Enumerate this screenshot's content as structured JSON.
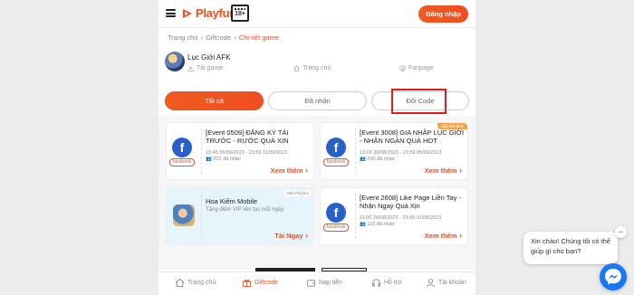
{
  "header": {
    "brand": "Playfun",
    "age_rating": "18+",
    "login_label": "Đăng nhập"
  },
  "breadcrumb": [
    "Trang chủ",
    "Giftcode",
    "Chi tiết game"
  ],
  "game": {
    "name": "Lục Giới AFK",
    "links": [
      {
        "label": "Tải game",
        "icon": "download-icon"
      },
      {
        "label": "Trang chủ",
        "icon": "home-icon"
      },
      {
        "label": "Fanpage",
        "icon": "facebook-icon"
      }
    ]
  },
  "tabs": [
    {
      "label": "Tất cả",
      "active": true
    },
    {
      "label": "Đã nhận",
      "active": false
    },
    {
      "label": "Đổi Code",
      "active": false
    }
  ],
  "cards": [
    {
      "title": "[Event 0509] ĐĂNG KÝ TẢI TRƯỚC - RƯỚC QUÀ XỊN",
      "time": "10:45 05/09/2023 - 23:59 11/09/2023",
      "count": "222 đã nhận",
      "source": "facebook",
      "action": "Xem thêm",
      "badge": ""
    },
    {
      "title": "[Event 3008] GIA NHẬP LỤC GIỚI - NHẬN NGÀN QUÀ HOT",
      "time": "10:00 30/08/2023 - 23:59 05/09/2023",
      "count": "290 đã nhận",
      "source": "facebook",
      "action": "Xem thêm",
      "badge": "Sắp kết thúc"
    },
    {
      "title": "Hoa Kiếm Mobile",
      "subtitle": "Tặng điểm VIP liên tục mỗi ngày",
      "action": "Tải Ngay",
      "badge": "Nhà Playfun"
    },
    {
      "title": "[Event 2608] Like Page Liền Tay - Nhận Ngay Quà Xịn",
      "time": "11:00 26/08/2023 - 23:59 31/08/2023",
      "count": "110 đã nhận",
      "source": "facebook",
      "action": "Xem thêm",
      "badge": ""
    }
  ],
  "bottom_nav": [
    {
      "label": "Trang chủ",
      "icon": "home-icon",
      "active": false
    },
    {
      "label": "Giftcode",
      "icon": "gift-icon",
      "active": true
    },
    {
      "label": "Nạp tiền",
      "icon": "wallet-icon",
      "active": false
    },
    {
      "label": "Hỗ trợ",
      "icon": "headset-icon",
      "active": false
    },
    {
      "label": "Tài khoản",
      "icon": "user-icon",
      "active": false
    }
  ],
  "chat": {
    "message": "Xin chào! Chúng tôi có thể giúp gì cho bạn?",
    "close": "−"
  },
  "colors": {
    "brand": "#f04e23",
    "facebook": "#2a61c9",
    "messenger": "#1877f2",
    "highlight": "#e41a1a"
  }
}
